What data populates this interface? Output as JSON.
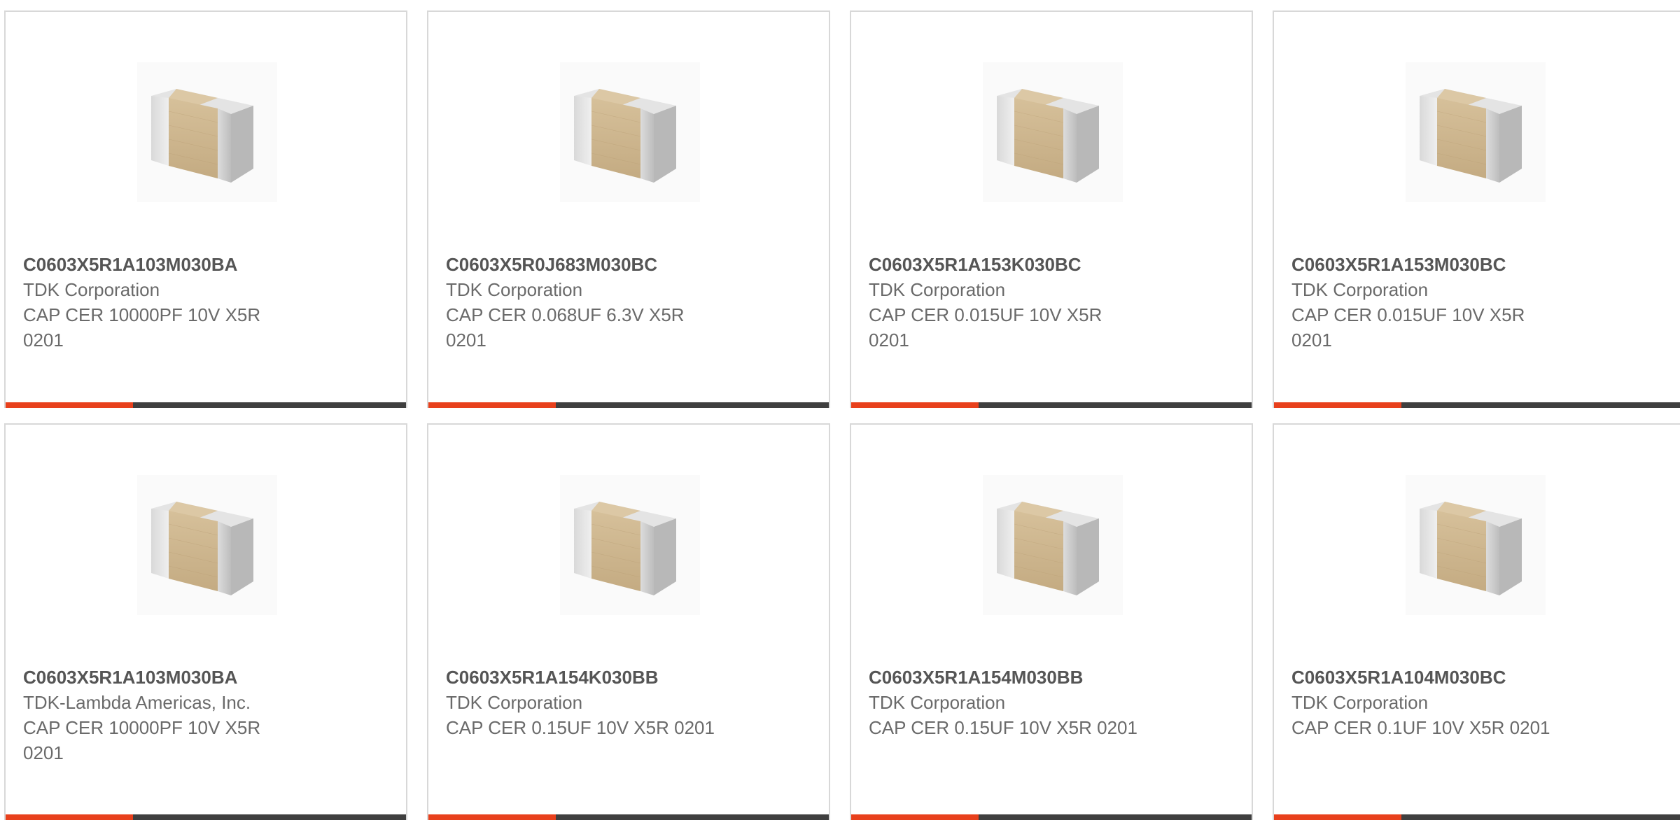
{
  "accent_color": "#e8401c",
  "bar_color": "#3f3f3f",
  "product_image_icon": "ceramic-capacitor-image",
  "products": [
    {
      "part": "C0603X5R1A103M030BA",
      "maker": "TDK Corporation",
      "desc": "CAP CER 10000PF 10V X5R 0201"
    },
    {
      "part": "C0603X5R0J683M030BC",
      "maker": "TDK Corporation",
      "desc": "CAP CER 0.068UF 6.3V X5R 0201"
    },
    {
      "part": "C0603X5R1A153K030BC",
      "maker": "TDK Corporation",
      "desc": "CAP CER 0.015UF 10V X5R 0201"
    },
    {
      "part": "C0603X5R1A153M030BC",
      "maker": "TDK Corporation",
      "desc": "CAP CER 0.015UF 10V X5R 0201"
    },
    {
      "part": "C0603X5R1A103M030BA",
      "maker": "TDK-Lambda Americas, Inc.",
      "desc": "CAP CER 10000PF 10V X5R 0201"
    },
    {
      "part": "C0603X5R1A154K030BB",
      "maker": "TDK Corporation",
      "desc": "CAP CER 0.15UF 10V X5R 0201"
    },
    {
      "part": "C0603X5R1A154M030BB",
      "maker": "TDK Corporation",
      "desc": "CAP CER 0.15UF 10V X5R 0201"
    },
    {
      "part": "C0603X5R1A104M030BC",
      "maker": "TDK Corporation",
      "desc": "CAP CER 0.1UF 10V X5R 0201"
    }
  ]
}
